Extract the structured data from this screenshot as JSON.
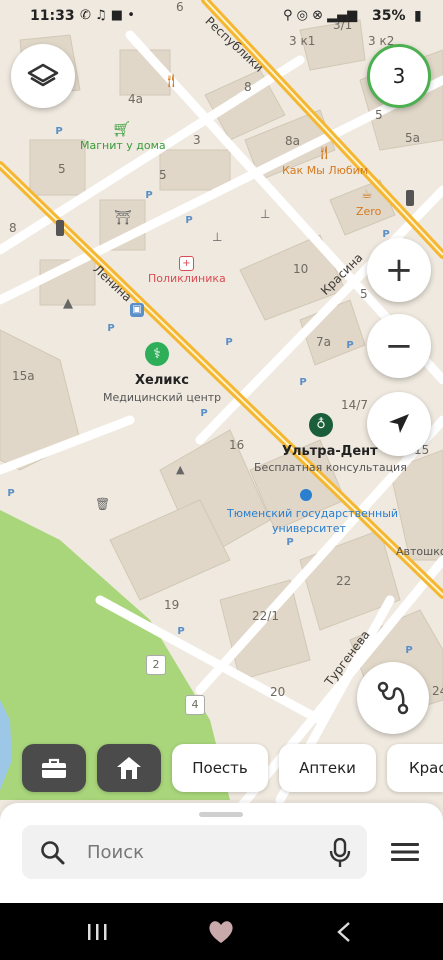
{
  "status": {
    "time": "11:33",
    "battery": "35%"
  },
  "map": {
    "buildings": [
      "3 к1",
      "3 к2",
      "3/1",
      "4а",
      "8",
      "8а",
      "3",
      "5",
      "5",
      "5а",
      "6",
      "5",
      "8",
      "10",
      "5",
      "7а",
      "15а",
      "14/7",
      "16",
      "15",
      "22",
      "22/1",
      "19",
      "20",
      "24",
      "2",
      "4"
    ],
    "streets": {
      "respubliki": "Республики",
      "lenina": "Ленина",
      "krasina": "Красина",
      "turgeneva": "Тургенева"
    },
    "pois": {
      "magnit": "Магнит у дома",
      "kak_my_lyubim": "Как Мы Любим",
      "zero": "Zero",
      "poliklinika": "Поликлиника",
      "heliks_name": "Хеликс",
      "heliks_sub": "Медицинский центр",
      "ultra_name": "Ультра-Дент",
      "ultra_sub": "Бесплатная консультация",
      "university_line1": "Тюменский государственный",
      "university_line2": "университет",
      "autoshkola": "Автошкол"
    },
    "parking_label": "P"
  },
  "controls": {
    "layers_icon": "layers-icon",
    "badge_count": "3",
    "zoom_in": "+",
    "zoom_out": "−",
    "locate_icon": "navigation-arrow-icon",
    "route_icon": "route-icon"
  },
  "chips": {
    "work_icon": "briefcase-icon",
    "home_icon": "home-icon",
    "eat": "Поесть",
    "pharmacies": "Аптеки",
    "beauty": "Крас"
  },
  "search": {
    "placeholder": "Поиск"
  },
  "colors": {
    "main_road": "#f5b731",
    "park": "#a9d67b",
    "badge_ring": "#4caf50",
    "poi_red": "#d94e54",
    "poi_orange": "#d47a1e",
    "poi_green": "#3a9c3a",
    "poi_blue": "#2a7fcf"
  }
}
